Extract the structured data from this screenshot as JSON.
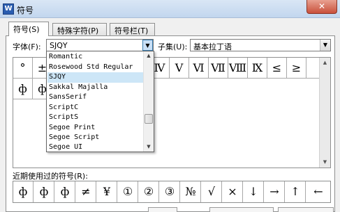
{
  "window": {
    "title": "符号",
    "app_icon": "W",
    "close_glyph": "✕"
  },
  "tabs": [
    {
      "label": "符号(S)"
    },
    {
      "label": "特殊字符(P)"
    },
    {
      "label": "符号栏(T)"
    }
  ],
  "font": {
    "label": "字体(F):",
    "value": "SJQY",
    "arrow": "▼"
  },
  "subset": {
    "label": "子集(U):",
    "value": "基本拉丁语",
    "arrow": "▼"
  },
  "grid": {
    "row1": [
      "°",
      "±",
      "Ⅳ",
      "Ⅴ",
      "Ⅵ",
      "Ⅶ",
      "Ⅷ",
      "Ⅸ",
      "≤",
      "≥"
    ],
    "row2": [
      "ф",
      "ф"
    ],
    "scroll_up": "▲",
    "scroll_down": "▼"
  },
  "font_dropdown": {
    "items": [
      "Romantic",
      "Rosewood Std Regular",
      "SJQY",
      "Sakkal Majalla",
      "SansSerif",
      "ScriptC",
      "ScriptS",
      "Segoe Print",
      "Segoe Script",
      "Segoe UI"
    ],
    "selected": "SJQY",
    "scroll_up": "▲",
    "scroll_down": "▼"
  },
  "recent": {
    "label": "近期使用过的符号(R):",
    "symbols": [
      "ф",
      "ф",
      "ф",
      "≠",
      "¥",
      "①",
      "②",
      "③",
      "№",
      "√",
      "×",
      "↓",
      "→",
      "↑",
      "←"
    ]
  }
}
